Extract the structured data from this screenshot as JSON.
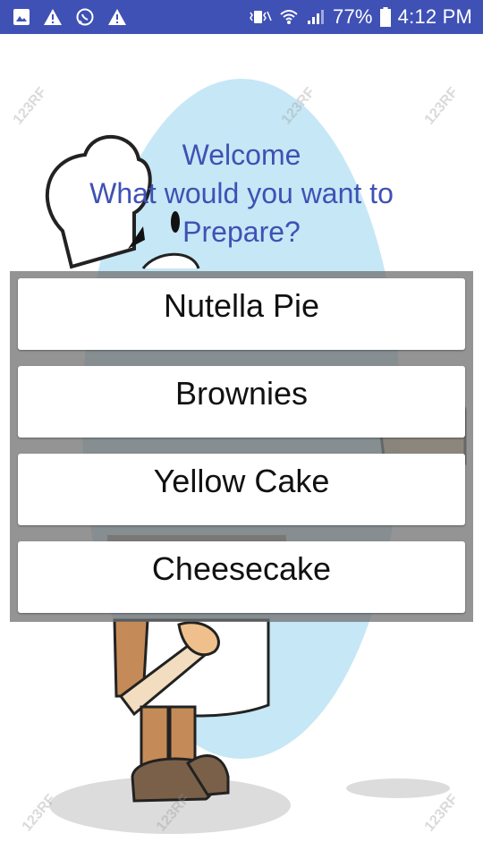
{
  "status_bar": {
    "left_icons": [
      "image-icon",
      "warning-icon",
      "whatsapp-icon",
      "warning-icon"
    ],
    "battery_percent": "77%",
    "time": "4:12 PM"
  },
  "header": {
    "line1": "Welcome",
    "line2": "What would you want to",
    "line3": "Prepare?"
  },
  "recipes": [
    {
      "label": "Nutella Pie"
    },
    {
      "label": "Brownies"
    },
    {
      "label": "Yellow Cake"
    },
    {
      "label": "Cheesecake"
    }
  ],
  "colors": {
    "status_bar": "#3f51b5",
    "heading_text": "#3f51b5",
    "background_oval": "#c6e7f5"
  }
}
